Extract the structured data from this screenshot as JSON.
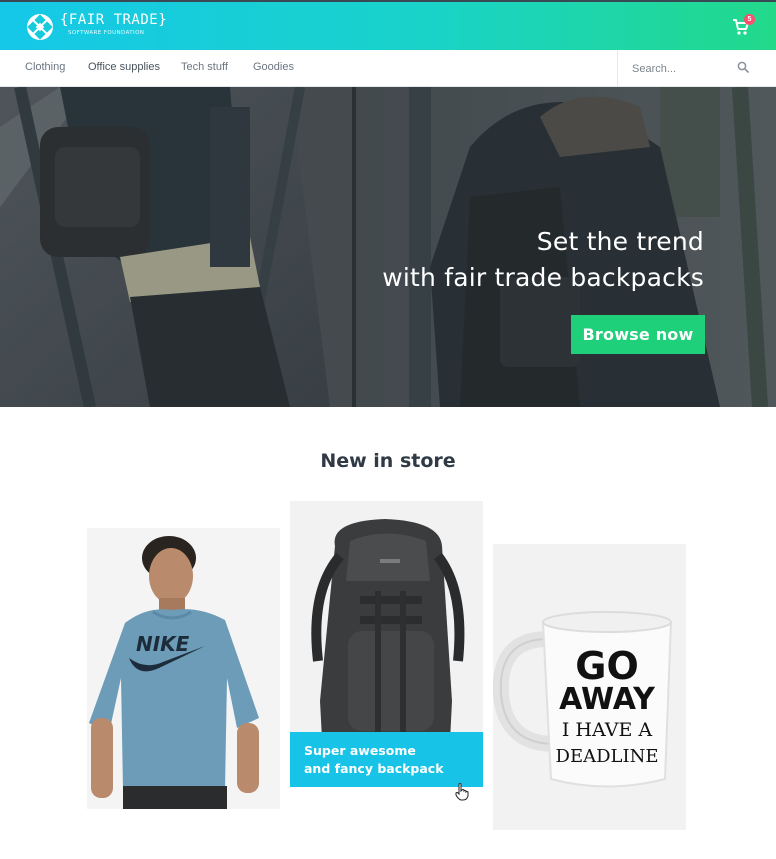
{
  "brand": {
    "name": "{FAIR TRADE}",
    "tagline": "SOFTWARE FOUNDATION"
  },
  "cart": {
    "count": "5"
  },
  "nav": {
    "items": [
      {
        "label": "Clothing"
      },
      {
        "label": "Office supplies"
      },
      {
        "label": "Tech stuff"
      },
      {
        "label": "Goodies"
      }
    ]
  },
  "search": {
    "placeholder": "Search..."
  },
  "hero": {
    "line1": "Set the trend",
    "line2": "with fair trade backpacks",
    "button_label": "Browse now"
  },
  "products_section": {
    "title": "New in store",
    "products": [
      {
        "name": "NIKE"
      },
      {
        "name": "Super awesome and fancy backpack",
        "caption_line1": "Super awesome",
        "caption_line2": "and fancy backpack"
      },
      {
        "mug_text1": "GO",
        "mug_text2": "AWAY",
        "mug_text3": "I HAVE A",
        "mug_text4": "DEADLINE"
      }
    ]
  },
  "colors": {
    "header_start": "#15c8e8",
    "header_end": "#22d98a",
    "cta_green": "#1ed07a",
    "caption_cyan": "#17c3e6",
    "badge_red": "#ff4d6d"
  }
}
